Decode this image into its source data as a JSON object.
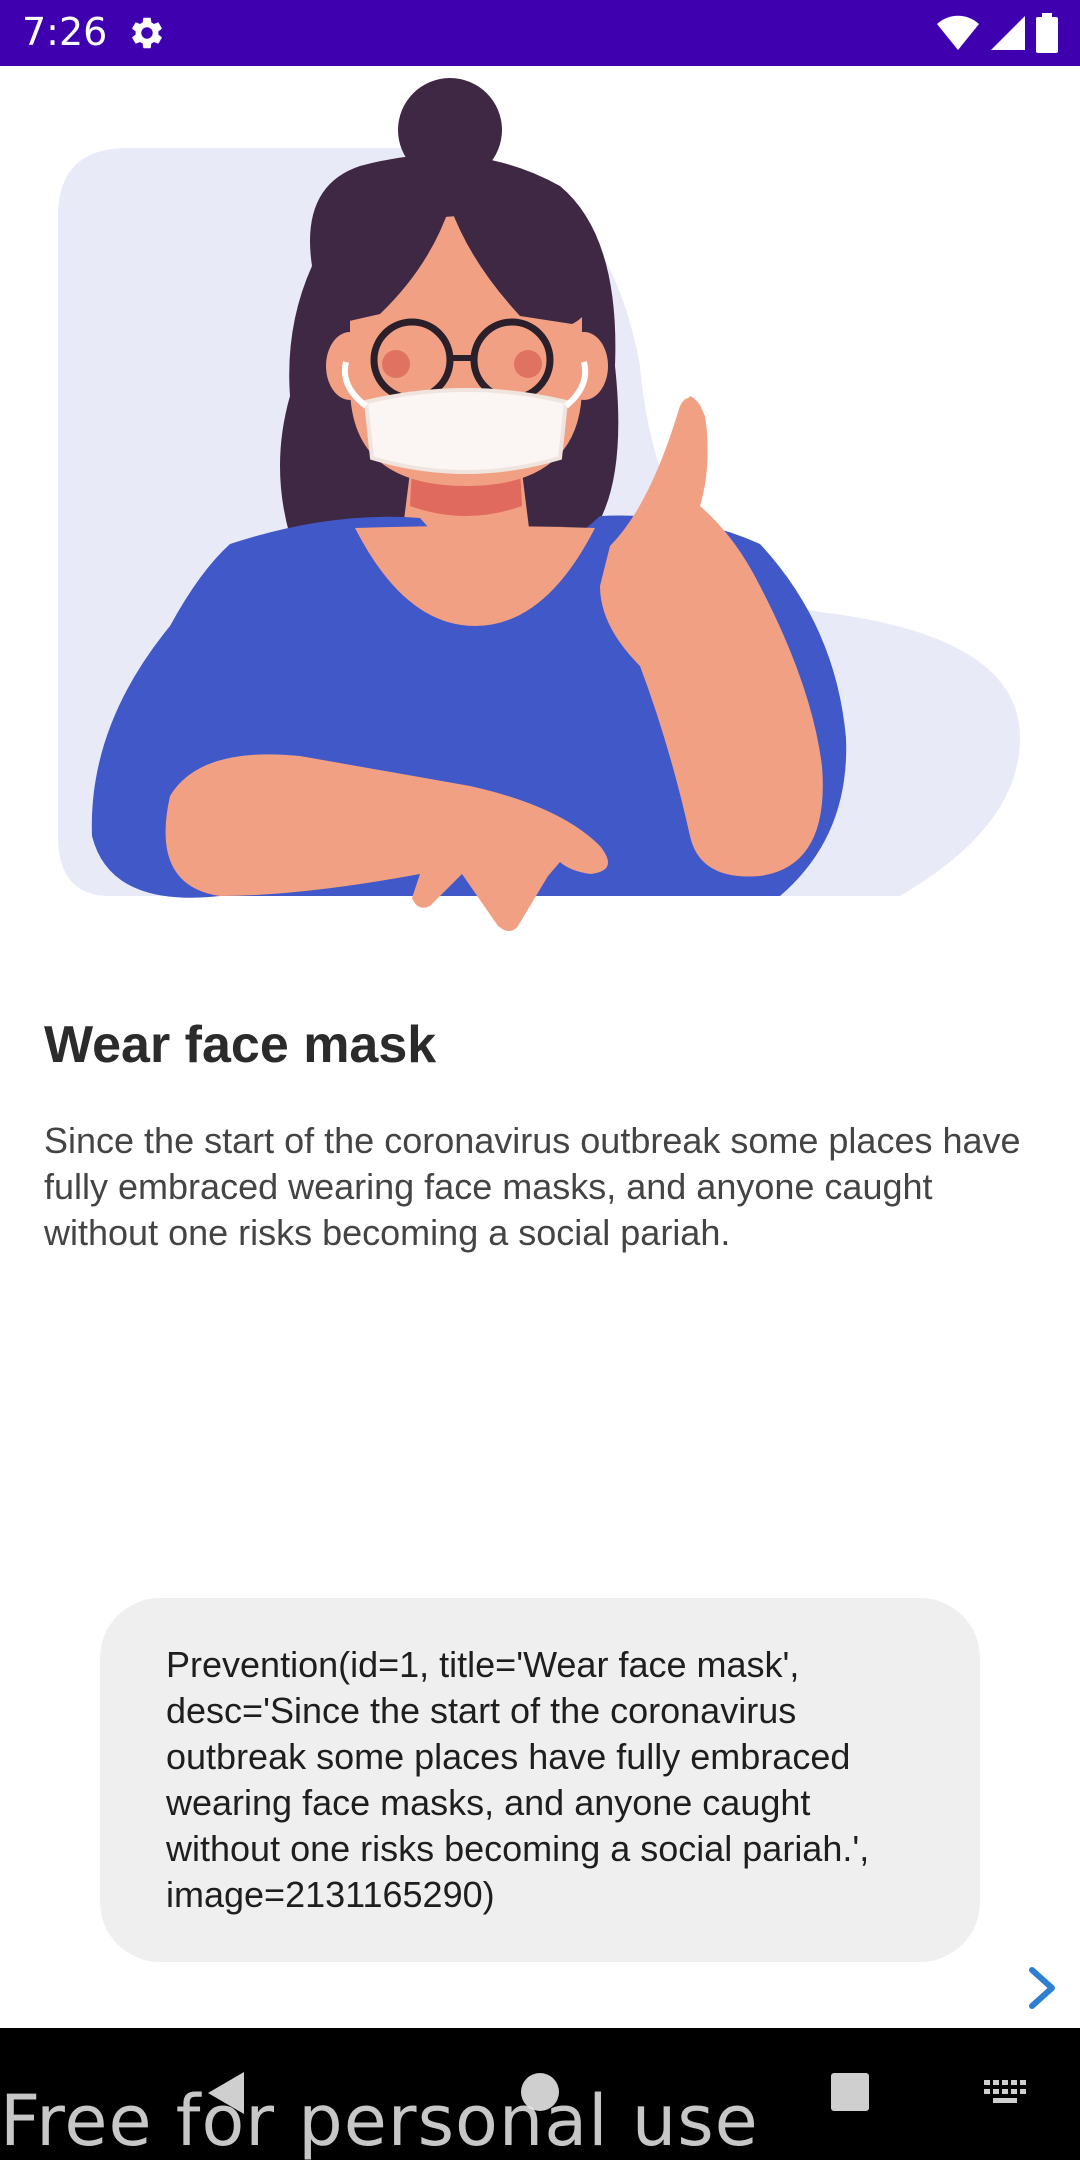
{
  "status_bar": {
    "time": "7:26",
    "icons": [
      "gear-icon",
      "wifi-icon",
      "signal-icon",
      "battery-icon"
    ],
    "background": "#3f00b0"
  },
  "illustration": {
    "subject": "woman-wearing-face-mask-thumbs-up",
    "colors": {
      "backdrop": "#e9eaf7",
      "hair": "#3f2844",
      "skin": "#f2a083",
      "shirt": "#4158c8",
      "mask": "#fbf6f3",
      "collar": "#e06a5d"
    }
  },
  "content": {
    "title": "Wear face mask",
    "description": "Since the start of the coronavirus outbreak some places have fully embraced wearing face masks, and anyone caught without one risks becoming a social pariah."
  },
  "toast": {
    "text": "Prevention(id=1, title='Wear face mask', desc='Since the start of the coronavirus outbreak some places have fully embraced wearing face masks, and anyone caught without one risks becoming a social pariah.', image=2131165290)"
  },
  "navigation": {
    "next_icon": "chevron-right-icon",
    "accent": "#2f7fd0"
  },
  "nav_bar": {
    "buttons": [
      "back-icon",
      "home-icon",
      "recents-icon",
      "keyboard-icon"
    ]
  },
  "watermark": {
    "text": "Free for personal use"
  }
}
